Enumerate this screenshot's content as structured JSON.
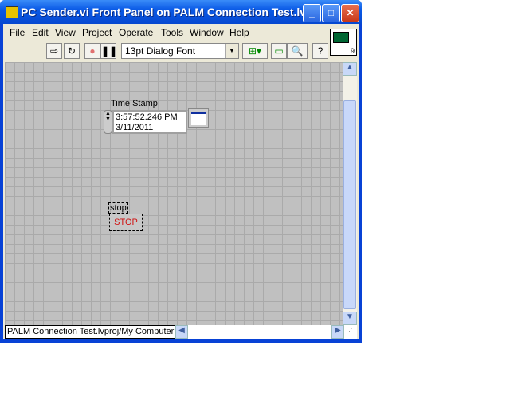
{
  "window": {
    "title": "PC Sender.vi Front Panel on PALM Connection Test.lv..."
  },
  "menu": [
    "File",
    "Edit",
    "View",
    "Project",
    "Operate",
    "Tools",
    "Window",
    "Help"
  ],
  "toolbar": {
    "font": "13pt Dialog Font",
    "connector_number": "9"
  },
  "controls": {
    "timestamp_label": "Time Stamp",
    "timestamp_time": "3:57:52.246 PM",
    "timestamp_date": "3/11/2011",
    "stop_label": "stop",
    "stop_button": "STOP"
  },
  "status": {
    "context": "PALM Connection Test.lvproj/My Computer"
  }
}
